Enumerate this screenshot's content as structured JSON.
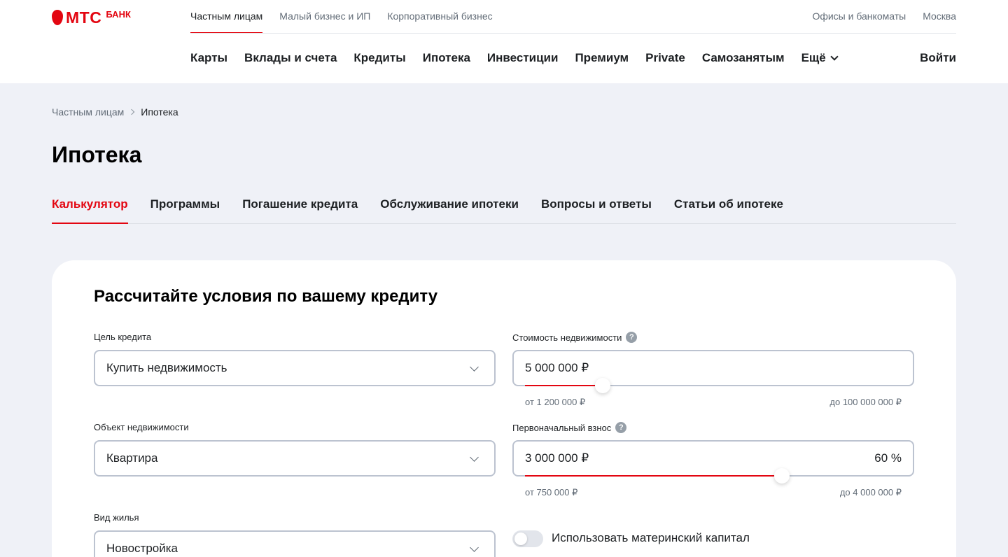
{
  "header": {
    "logo_text": "МТС",
    "logo_sub": "БАНК",
    "top_nav": [
      "Частным лицам",
      "Малый бизнес и ИП",
      "Корпоративный бизнес"
    ],
    "top_right": [
      "Офисы и банкоматы",
      "Москва"
    ],
    "main_nav": [
      "Карты",
      "Вклады и счета",
      "Кредиты",
      "Ипотека",
      "Инвестиции",
      "Премиум",
      "Private",
      "Самозанятым",
      "Ещё"
    ],
    "login": "Войти"
  },
  "breadcrumb": [
    "Частным лицам",
    "Ипотека"
  ],
  "page_title": "Ипотека",
  "tabs": [
    "Калькулятор",
    "Программы",
    "Погашение кредита",
    "Обслуживание ипотеки",
    "Вопросы и ответы",
    "Статьи об ипотеке"
  ],
  "calculator": {
    "title": "Рассчитайте условия по вашему кредиту",
    "goal": {
      "label": "Цель кредита",
      "value": "Купить недвижимость"
    },
    "object": {
      "label": "Объект недвижимости",
      "value": "Квартира"
    },
    "housing": {
      "label": "Вид жилья",
      "value": "Новостройка"
    },
    "price": {
      "label": "Стоимость недвижимости",
      "value": "5 000 000 ₽",
      "min": "от 1 200 000 ₽",
      "max": "до 100 000 000 ₽",
      "slider_fraction": 0.207
    },
    "down_payment": {
      "label": "Первоначальный взнос",
      "value": "3 000 000 ₽",
      "percent": "60 %",
      "min": "от 750 000 ₽",
      "max": "до 4 000 000 ₽",
      "slider_fraction": 0.683
    },
    "maternity": {
      "label": "Использовать материнский капитал",
      "enabled": false
    }
  },
  "colors": {
    "accent": "#e30611",
    "background": "#eff1f7"
  }
}
